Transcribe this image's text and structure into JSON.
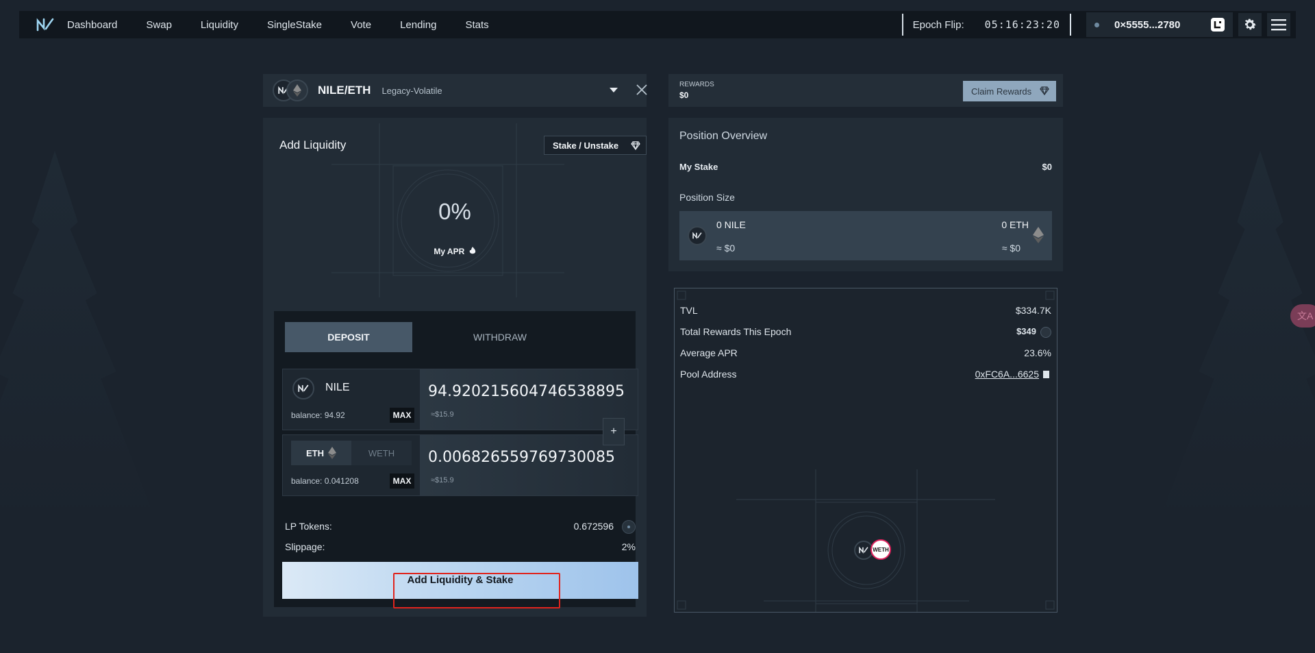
{
  "nav": {
    "links": [
      "Dashboard",
      "Swap",
      "Liquidity",
      "SingleStake",
      "Vote",
      "Lending",
      "Stats"
    ],
    "epoch_label": "Epoch Flip:",
    "epoch_time": "05:16:23:20",
    "wallet_address": "0×5555...2780"
  },
  "pair": {
    "name": "NILE/ETH",
    "type": "Legacy-Volatile"
  },
  "left": {
    "title": "Add Liquidity",
    "stake_button": "Stake / Unstake",
    "apr_value": "0%",
    "apr_label": "My APR",
    "tabs": {
      "deposit": "DEPOSIT",
      "withdraw": "WITHDRAW"
    },
    "token1": {
      "name": "NILE",
      "balance": "balance: 94.92",
      "max": "MAX",
      "amount": "94.920215604746538895",
      "usd": "≈$15.9"
    },
    "token2": {
      "option_on": "ETH",
      "option_off": "WETH",
      "balance": "balance: 0.041208",
      "max": "MAX",
      "amount": "0.006826559769730085",
      "usd": "≈$15.9"
    },
    "plus": "+",
    "lp_tokens_label": "LP Tokens:",
    "lp_tokens_value": "0.672596",
    "slippage_label": "Slippage:",
    "slippage_value": "2%",
    "add_button": "Add Liquidity & Stake"
  },
  "rewards": {
    "label": "REWARDS",
    "value": "$0",
    "claim_button": "Claim Rewards"
  },
  "position": {
    "title": "Position Overview",
    "my_stake_label": "My Stake",
    "my_stake_value": "$0",
    "size_label": "Position Size",
    "nile_amount": "0 NILE",
    "nile_usd": "≈ $0",
    "eth_amount": "0 ETH",
    "eth_usd": "≈ $0"
  },
  "stats": {
    "tvl_label": "TVL",
    "tvl_value": "$334.7K",
    "rewards_label": "Total Rewards This Epoch",
    "rewards_value": "$349",
    "apr_label": "Average APR",
    "apr_value": "23.6%",
    "address_label": "Pool Address",
    "address_value": "0xFC6A...6625",
    "weth_badge": "WETH"
  },
  "translate": "文A",
  "colors": {
    "accent_gradient_start": "#dbe9f6",
    "accent_gradient_end": "#9ec3eb",
    "highlight": "#e0241d"
  }
}
